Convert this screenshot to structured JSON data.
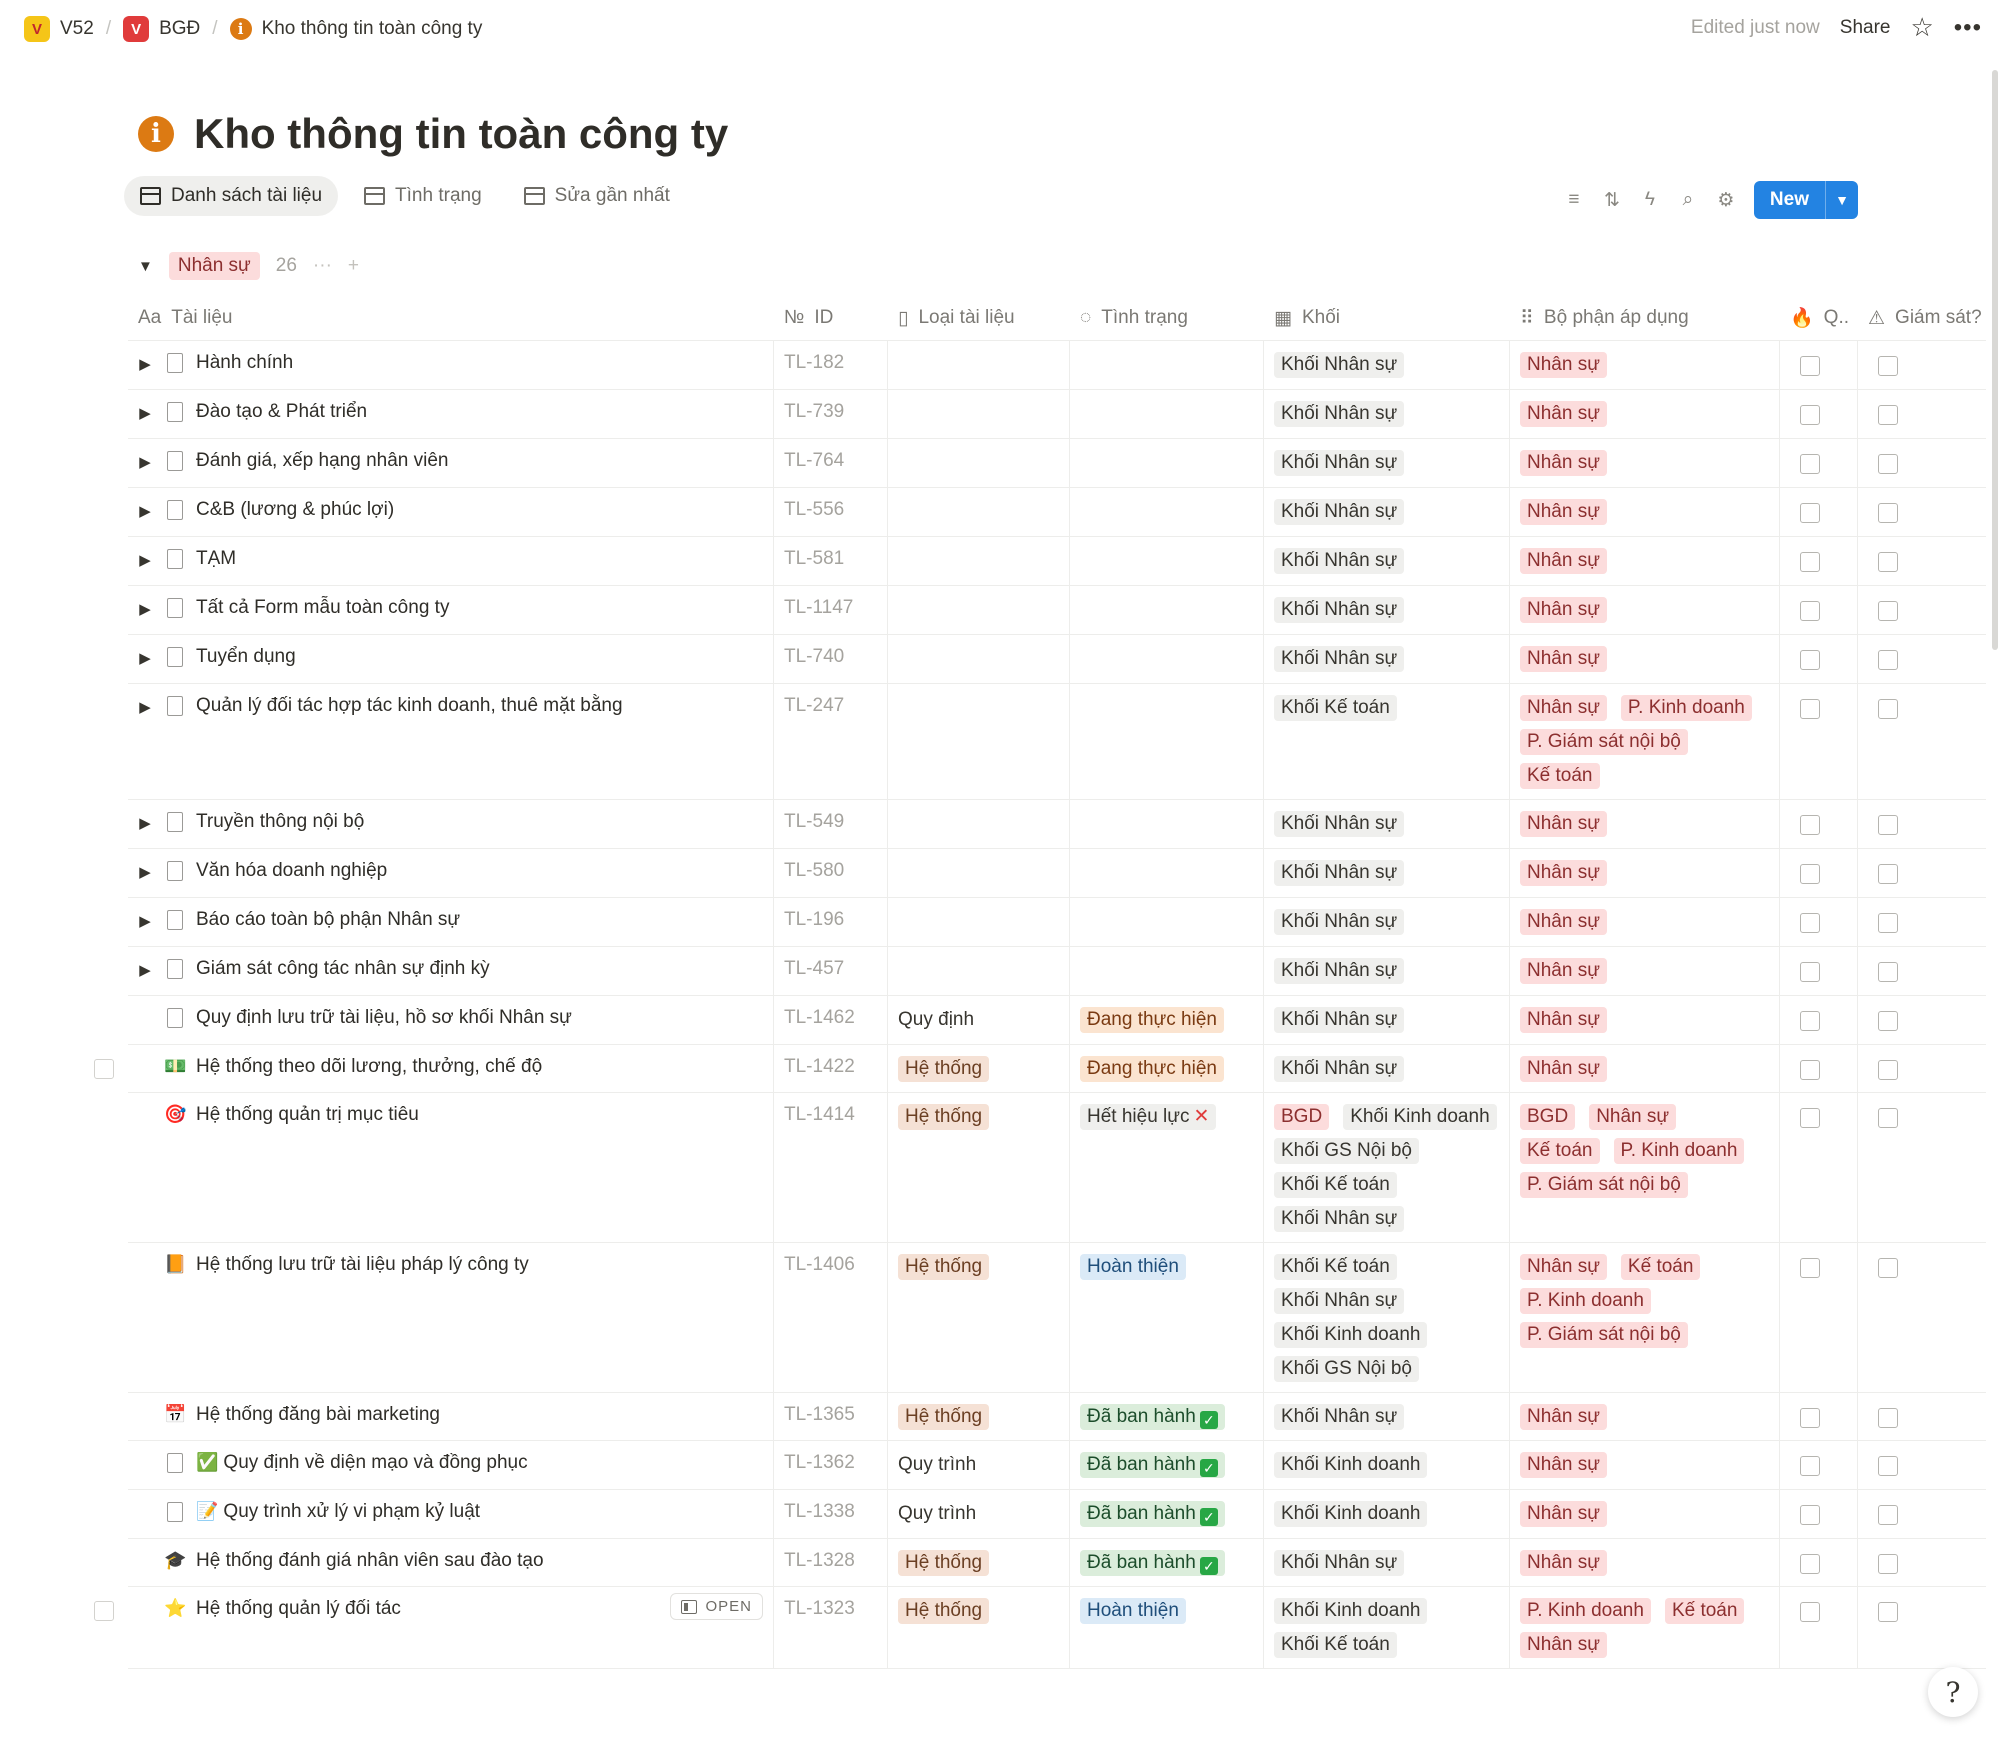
{
  "breadcrumb": [
    {
      "label": "V52",
      "logo": "V"
    },
    {
      "label": "BGĐ",
      "logo": "V"
    },
    {
      "label": "Kho thông tin toàn công ty",
      "icon": "info-icon"
    }
  ],
  "topbar": {
    "edited": "Edited just now",
    "share": "Share"
  },
  "page": {
    "title": "Kho thông tin toàn công ty"
  },
  "views": [
    {
      "label": "Danh sách tài liệu",
      "active": true
    },
    {
      "label": "Tình trạng",
      "active": false
    },
    {
      "label": "Sửa gần nhất",
      "active": false
    }
  ],
  "toolbar": {
    "new_label": "New"
  },
  "group": {
    "label": "Nhân sự",
    "count": "26"
  },
  "columns": {
    "doc": "Tài liệu",
    "id": "ID",
    "type": "Loại tài liệu",
    "status": "Tình trạng",
    "khoi": "Khối",
    "bophan": "Bộ phận áp dụng",
    "q": "Q..",
    "gs": "Giám sát?"
  },
  "colors": {
    "accent": "#2383e2",
    "tag_red": "#fcdcdc",
    "tag_gray": "#efefed",
    "info_orange": "#dc7a13"
  },
  "rows": [
    {
      "name": "Hành chính",
      "id": "TL-182",
      "toggle": true,
      "icon": "page",
      "type": [],
      "status": [],
      "khoi": [
        "Khối Nhân sự"
      ],
      "bophan": [
        "Nhân sự"
      ]
    },
    {
      "name": "Đào tạo & Phát triển",
      "id": "TL-739",
      "toggle": true,
      "icon": "page",
      "type": [],
      "status": [],
      "khoi": [
        "Khối Nhân sự"
      ],
      "bophan": [
        "Nhân sự"
      ]
    },
    {
      "name": "Đánh giá, xếp hạng nhân viên",
      "id": "TL-764",
      "toggle": true,
      "icon": "page",
      "type": [],
      "status": [],
      "khoi": [
        "Khối Nhân sự"
      ],
      "bophan": [
        "Nhân sự"
      ]
    },
    {
      "name": "C&B (lương & phúc lợi)",
      "id": "TL-556",
      "toggle": true,
      "icon": "page",
      "type": [],
      "status": [],
      "khoi": [
        "Khối Nhân sự"
      ],
      "bophan": [
        "Nhân sự"
      ]
    },
    {
      "name": "TẠM",
      "id": "TL-581",
      "toggle": true,
      "icon": "page",
      "type": [],
      "status": [],
      "khoi": [
        "Khối Nhân sự"
      ],
      "bophan": [
        "Nhân sự"
      ]
    },
    {
      "name": "Tất cả Form mẫu toàn công ty",
      "id": "TL-1147",
      "toggle": true,
      "icon": "page",
      "type": [],
      "status": [],
      "khoi": [
        "Khối Nhân sự"
      ],
      "bophan": [
        "Nhân sự"
      ]
    },
    {
      "name": "Tuyển dụng",
      "id": "TL-740",
      "toggle": true,
      "icon": "page",
      "type": [],
      "status": [],
      "khoi": [
        "Khối Nhân sự"
      ],
      "bophan": [
        "Nhân sự"
      ]
    },
    {
      "name": "Quản lý đối tác hợp tác kinh doanh, thuê mặt bằng",
      "id": "TL-247",
      "toggle": true,
      "icon": "page",
      "type": [],
      "status": [],
      "khoi": [
        "Khối Kế toán"
      ],
      "bophan": [
        "Nhân sự",
        "P. Kinh doanh",
        "P. Giám sát nội bộ",
        "Kế toán"
      ]
    },
    {
      "name": "Truyền thông nội bộ",
      "id": "TL-549",
      "toggle": true,
      "icon": "page",
      "type": [],
      "status": [],
      "khoi": [
        "Khối Nhân sự"
      ],
      "bophan": [
        "Nhân sự"
      ]
    },
    {
      "name": "Văn hóa doanh nghiệp",
      "id": "TL-580",
      "toggle": true,
      "icon": "page",
      "type": [],
      "status": [],
      "khoi": [
        "Khối Nhân sự"
      ],
      "bophan": [
        "Nhân sự"
      ]
    },
    {
      "name": "Báo cáo toàn bộ phận Nhân sự",
      "id": "TL-196",
      "toggle": true,
      "icon": "page",
      "type": [],
      "status": [],
      "khoi": [
        "Khối Nhân sự"
      ],
      "bophan": [
        "Nhân sự"
      ]
    },
    {
      "name": "Giám sát công tác nhân sự định kỳ",
      "id": "TL-457",
      "toggle": true,
      "icon": "page",
      "type": [],
      "status": [],
      "khoi": [
        "Khối Nhân sự"
      ],
      "bophan": [
        "Nhân sự"
      ]
    },
    {
      "name": "Quy định lưu trữ tài liệu, hồ sơ khối Nhân sự",
      "id": "TL-1462",
      "toggle": false,
      "icon": "page",
      "type": [
        {
          "label": "Quy định",
          "style": "plain"
        }
      ],
      "status": [
        {
          "label": "Đang thực hiện",
          "style": "orange"
        }
      ],
      "khoi": [
        "Khối Nhân sự"
      ],
      "bophan": [
        "Nhân sự"
      ]
    },
    {
      "name": "Hệ thống theo dõi lương, thưởng, chế độ",
      "id": "TL-1422",
      "toggle": false,
      "icon": "money",
      "icon_glyph": "💵",
      "left_checkbox": true,
      "type": [
        {
          "label": "Hệ thống",
          "style": "beige"
        }
      ],
      "status": [
        {
          "label": "Đang thực hiện",
          "style": "orange"
        }
      ],
      "khoi": [
        "Khối Nhân sự"
      ],
      "bophan": [
        "Nhân sự"
      ]
    },
    {
      "name": "Hệ thống quản trị mục tiêu",
      "id": "TL-1414",
      "toggle": false,
      "icon": "target",
      "icon_glyph": "🎯",
      "type": [
        {
          "label": "Hệ thống",
          "style": "beige"
        }
      ],
      "status": [
        {
          "label": "Hết hiệu lực",
          "style": "gray",
          "suffix": "x"
        }
      ],
      "khoi": [
        "BGD",
        "Khối Kinh doanh",
        "Khối GS Nội bộ",
        "Khối Kế toán",
        "Khối Nhân sự"
      ],
      "bophan": [
        "BGD",
        "Nhân sự",
        "Kế toán",
        "P. Kinh doanh",
        "P. Giám sát nội bộ"
      ],
      "khoi_red": [
        "BGD"
      ]
    },
    {
      "name": "Hệ thống lưu trữ tài liệu pháp lý công ty",
      "id": "TL-1406",
      "toggle": false,
      "icon": "book",
      "icon_glyph": "📙",
      "type": [
        {
          "label": "Hệ thống",
          "style": "beige"
        }
      ],
      "status": [
        {
          "label": "Hoàn thiện",
          "style": "blue"
        }
      ],
      "khoi": [
        "Khối Kế toán",
        "Khối Nhân sự",
        "Khối Kinh doanh",
        "Khối GS Nội bộ"
      ],
      "bophan": [
        "Nhân sự",
        "Kế toán",
        "P. Kinh doanh",
        "P. Giám sát nội bộ"
      ]
    },
    {
      "name": "Hệ thống đăng bài marketing",
      "id": "TL-1365",
      "toggle": false,
      "icon": "calendar",
      "icon_glyph": "📅",
      "type": [
        {
          "label": "Hệ thống",
          "style": "beige"
        }
      ],
      "status": [
        {
          "label": "Đã ban hành",
          "style": "green",
          "suffix": "check"
        }
      ],
      "khoi": [
        "Khối Nhân sự"
      ],
      "bophan": [
        "Nhân sự"
      ]
    },
    {
      "name": "Quy định về diện mạo và đồng phục",
      "id": "TL-1362",
      "toggle": false,
      "icon": "page",
      "prefix_glyph": "✅",
      "type": [
        {
          "label": "Quy trình",
          "style": "plain"
        }
      ],
      "status": [
        {
          "label": "Đã ban hành",
          "style": "green",
          "suffix": "check"
        }
      ],
      "khoi": [
        "Khối Kinh doanh"
      ],
      "bophan": [
        "Nhân sự"
      ]
    },
    {
      "name": "Quy trình xử lý vi phạm kỷ luật",
      "id": "TL-1338",
      "toggle": false,
      "icon": "page",
      "prefix_glyph": "📝",
      "type": [
        {
          "label": "Quy trình",
          "style": "plain"
        }
      ],
      "status": [
        {
          "label": "Đã ban hành",
          "style": "green",
          "suffix": "check"
        }
      ],
      "khoi": [
        "Khối Kinh doanh"
      ],
      "bophan": [
        "Nhân sự"
      ]
    },
    {
      "name": "Hệ thống đánh giá nhân viên sau đào tạo",
      "id": "TL-1328",
      "toggle": false,
      "icon": "grad",
      "icon_glyph": "🎓",
      "type": [
        {
          "label": "Hệ thống",
          "style": "beige"
        }
      ],
      "status": [
        {
          "label": "Đã ban hành",
          "style": "green",
          "suffix": "check"
        }
      ],
      "khoi": [
        "Khối Nhân sự"
      ],
      "bophan": [
        "Nhân sự"
      ]
    },
    {
      "name": "Hệ thống quản lý đối tác",
      "id": "TL-1323",
      "toggle": false,
      "icon": "star",
      "icon_glyph": "⭐",
      "left_checkbox": true,
      "open": "OPEN",
      "type": [
        {
          "label": "Hệ thống",
          "style": "beige"
        }
      ],
      "status": [
        {
          "label": "Hoàn thiện",
          "style": "blue"
        }
      ],
      "khoi": [
        "Khối Kinh doanh",
        "Khối Kế toán"
      ],
      "bophan": [
        "P. Kinh doanh",
        "Kế toán",
        "Nhân sự"
      ]
    }
  ]
}
